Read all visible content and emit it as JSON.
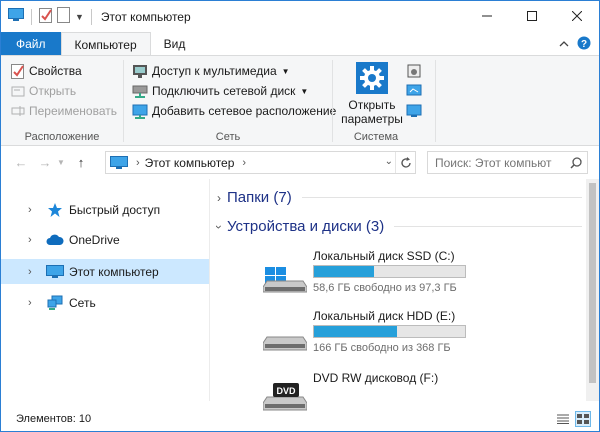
{
  "window": {
    "title": "Этот компьютер",
    "accent": "#1979ca"
  },
  "tabs": [
    {
      "label": "Файл"
    },
    {
      "label": "Компьютер"
    },
    {
      "label": "Вид"
    }
  ],
  "ribbon": {
    "location": {
      "label": "Расположение",
      "properties": "Свойства",
      "open": "Открыть",
      "rename": "Переименовать"
    },
    "network": {
      "label": "Сеть",
      "media": "Доступ к мультимедиа",
      "map_drive": "Подключить сетевой диск",
      "add_location": "Добавить сетевое расположение"
    },
    "system": {
      "label": "Система",
      "open_settings": "Открыть параметры"
    }
  },
  "address": {
    "crumb": "Этот компьютер",
    "search_placeholder": "Поиск: Этот компьют"
  },
  "sidebar": {
    "items": [
      {
        "label": "Быстрый доступ",
        "icon": "star-icon"
      },
      {
        "label": "OneDrive",
        "icon": "cloud-icon"
      },
      {
        "label": "Этот компьютер",
        "icon": "computer-icon",
        "selected": true
      },
      {
        "label": "Сеть",
        "icon": "network-icon"
      }
    ]
  },
  "main": {
    "folders": "Папки (7)",
    "devices": "Устройства и диски (3)",
    "drives": [
      {
        "name": "Локальный диск SSD (C:)",
        "free": "58,6 ГБ свободно из 97,3 ГБ",
        "used_fraction": 0.4,
        "icon": "windows-drive-icon"
      },
      {
        "name": "Локальный диск HDD (E:)",
        "free": "166 ГБ свободно из 368 ГБ",
        "used_fraction": 0.55,
        "icon": "hard-drive-icon"
      },
      {
        "name": "DVD RW дисковод (F:)",
        "free": "",
        "icon": "dvd-drive-icon",
        "badge": "DVD"
      }
    ]
  },
  "status": {
    "count": "Элементов: 10"
  }
}
